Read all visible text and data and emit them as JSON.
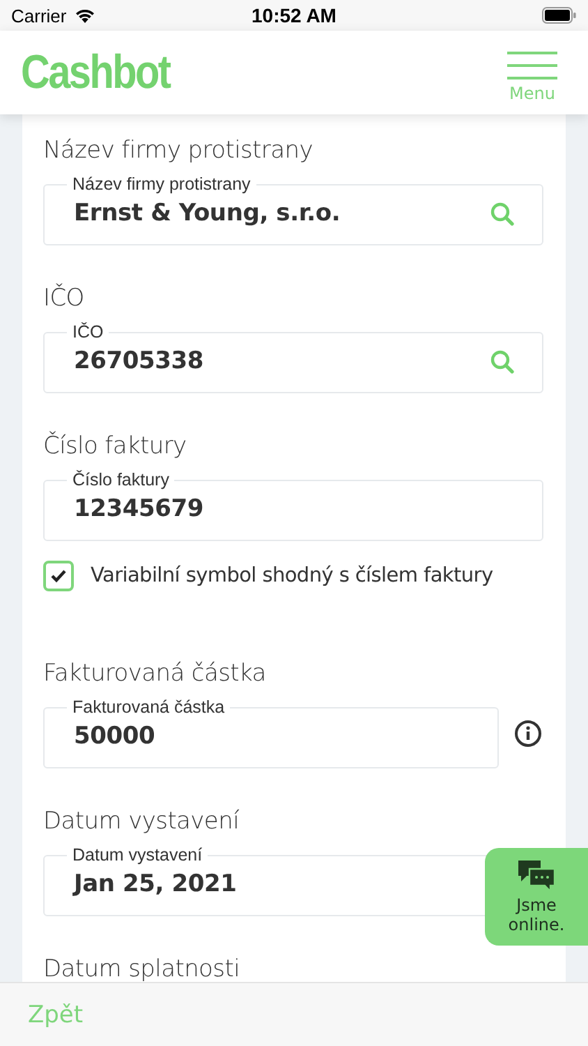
{
  "status_bar": {
    "carrier": "Carrier",
    "time": "10:52 AM"
  },
  "header": {
    "logo": "Cashbot",
    "menu_label": "Menu"
  },
  "sections": [
    {
      "kind": "field",
      "heading": "Název firmy protistrany",
      "label": "Název firmy protistrany",
      "value": "Ernst & Young, s.r.o.",
      "search_button": true
    },
    {
      "kind": "field",
      "heading": "IČO",
      "label": "IČO",
      "value": "26705338",
      "search_button": true
    },
    {
      "kind": "field",
      "heading": "Číslo faktury",
      "label": "Číslo faktury",
      "value": "12345679"
    },
    {
      "kind": "checkbox",
      "text": "Variabilní symbol shodný s číslem faktury",
      "checked": true
    },
    {
      "kind": "field",
      "heading": "Fakturovaná částka",
      "label": "Fakturovaná částka",
      "value": "50000",
      "info_button": true
    },
    {
      "kind": "field",
      "heading": "Datum vystavení",
      "label": "Datum vystavení",
      "value": "Jan 25, 2021"
    },
    {
      "kind": "heading",
      "heading": "Datum splatnosti"
    }
  ],
  "chat_widget": {
    "text": "Jsme online."
  },
  "bottom_bar": {
    "back": "Zpět"
  }
}
